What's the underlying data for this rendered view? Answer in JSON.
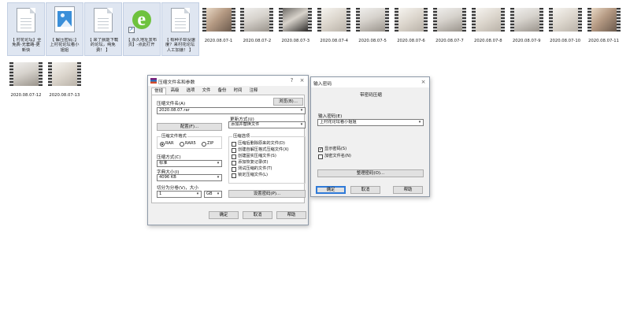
{
  "files": [
    {
      "label": "【 村花论坛】全\n免费-无套路-更\n新快",
      "icon": "document-icon",
      "kind": "doc",
      "selected": true
    },
    {
      "label": "【 解压密码：】\n上村花论坛看小\n姐姐",
      "icon": "image-icon",
      "kind": "img",
      "selected": true
    },
    {
      "label": "【 来了就能下载\n的论坛，纯免\n费！ 】",
      "icon": "document-icon",
      "kind": "doc",
      "selected": true
    },
    {
      "label": "【 永久地址发布\n页】-点此打开",
      "icon": "internet-shortcut-icon",
      "kind": "ie",
      "selected": true
    },
    {
      "label": "【 有种子却没速\n度？来村花论坛\n人工加速！ 】",
      "icon": "document-icon",
      "kind": "doc",
      "selected": true
    },
    {
      "label": "2020.08.07-1",
      "kind": "video",
      "frame": "portrait"
    },
    {
      "label": "2020.08.07-2",
      "kind": "video",
      "frame": "room"
    },
    {
      "label": "2020.08.07-3",
      "kind": "video",
      "frame": "dark"
    },
    {
      "label": "2020.08.07-4",
      "kind": "video",
      "frame": "bright"
    },
    {
      "label": "2020.08.07-5",
      "kind": "video",
      "frame": "room"
    },
    {
      "label": "2020.08.07-6",
      "kind": "video",
      "frame": "bright"
    },
    {
      "label": "2020.08.07-7",
      "kind": "video",
      "frame": "room"
    },
    {
      "label": "2020.08.07-8",
      "kind": "video",
      "frame": "bright"
    },
    {
      "label": "2020.08.07-9",
      "kind": "video",
      "frame": "room"
    },
    {
      "label": "2020.08.07-10",
      "kind": "video",
      "frame": "bright"
    },
    {
      "label": "2020.08.07-11",
      "kind": "video",
      "frame": "portrait"
    },
    {
      "label": "2020.08.07-12",
      "kind": "video",
      "frame": "room"
    },
    {
      "label": "2020.08.07-13",
      "kind": "video",
      "frame": "bright"
    }
  ],
  "archive_dialog": {
    "title": "压缩文件名和参数",
    "help_glyph": "?",
    "close_glyph": "×",
    "tabs": [
      "常规",
      "高级",
      "选项",
      "文件",
      "备份",
      "时间",
      "注释"
    ],
    "archive_name_label": "压缩文件名(A)",
    "browse_button": "浏览(B)...",
    "archive_name_value": "2020.08.07.rar",
    "update_mode_label": "更新方式(U)",
    "update_mode_value": "添加并替换文件",
    "profiles_button": "配置(F)...",
    "format_group_title": "压缩文件格式",
    "format_options": [
      "RAR",
      "RAR5",
      "ZIP"
    ],
    "format_selected": "RAR",
    "method_label": "压缩方式(C)",
    "method_value": "标准",
    "dict_label": "字典大小(I)",
    "dict_value": "4096 KB",
    "split_label": "切分为分卷(V)，大小",
    "split_value": "1",
    "split_unit": "GB",
    "options_group_title": "压缩选项",
    "options": [
      "压缩后删除原来的文件(D)",
      "创建自解压格式压缩文件(X)",
      "创建固实压缩文件(S)",
      "添加恢复记录(E)",
      "测试压缩的文件(T)",
      "锁定压缩文件(L)"
    ],
    "set_password_button": "设置密码(P)...",
    "ok_button": "确定",
    "cancel_button": "取消",
    "help_button": "帮助"
  },
  "password_dialog": {
    "title": "输入密码",
    "close_glyph": "×",
    "heading": "带密码压缩",
    "password_label": "输入密码(E)",
    "password_value": "上村花论坛看小姐姐",
    "show_password_label": "显示密码(S)",
    "encrypt_names_label": "加密文件名(N)",
    "show_password_checked": true,
    "encrypt_names_checked": false,
    "organize_button": "整理密码(O)...",
    "ok_button": "确定",
    "cancel_button": "取消",
    "help_button": "帮助"
  }
}
